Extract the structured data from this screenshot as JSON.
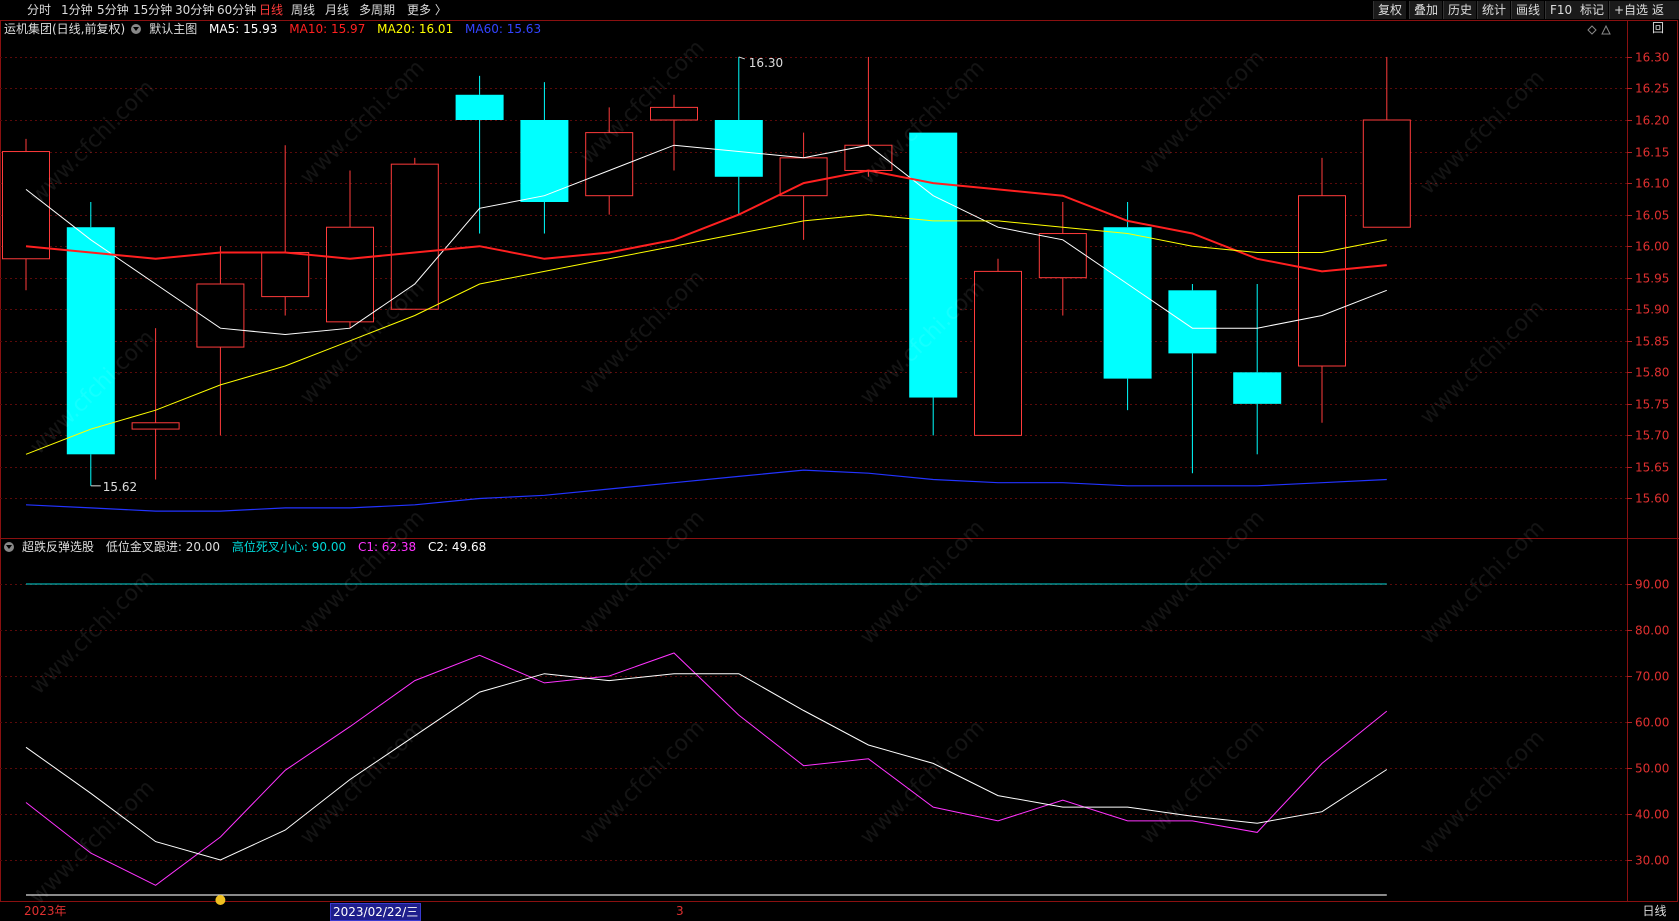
{
  "toolbar": {
    "periods": [
      "分时",
      "1分钟",
      "5分钟",
      "15分钟",
      "30分钟",
      "60分钟",
      "日线",
      "周线",
      "月线",
      "多周期",
      "更多 〉"
    ],
    "active_period": "日线",
    "right_buttons": [
      "复权",
      "叠加",
      "历史",
      "统计",
      "画线",
      "F10",
      "标记",
      "+自选",
      "返回"
    ]
  },
  "main_legend": {
    "stock": "运机集团(日线,前复权)",
    "template": "默认主图",
    "ma5": "MA5: 15.93",
    "ma10": "MA10: 15.97",
    "ma20": "MA20: 16.01",
    "ma60": "MA60: 15.63"
  },
  "sub_legend": {
    "name": "超跌反弹选股",
    "low": "低位金叉跟进: 20.00",
    "high": "高位死叉小心: 90.00",
    "c1": "C1: 62.38",
    "c2": "C2: 49.68"
  },
  "colors": {
    "up": "#ff3b3b",
    "down": "#00ffff",
    "ma5": "#ffffff",
    "ma10": "#ff2020",
    "ma20": "#ffff00",
    "ma60": "#2233ff",
    "c1": "#ff33ff",
    "c2": "#ffffff",
    "axis": "#e03030"
  },
  "annotations": {
    "high": "16.30",
    "low": "15.62"
  },
  "bottom": {
    "year_label": "2023年",
    "current_date": "2023/02/22/三",
    "month_mark": "3",
    "period_box": "日线"
  },
  "watermark": "www.cfchi.com",
  "chart_data": [
    {
      "type": "candlestick",
      "ylim": [
        15.55,
        16.33
      ],
      "y_ticks": [
        "16.30",
        "16.25",
        "16.20",
        "16.15",
        "16.10",
        "16.05",
        "16.00",
        "15.95",
        "15.90",
        "15.85",
        "15.80",
        "15.75",
        "15.70",
        "15.65",
        "15.60"
      ],
      "candles": [
        {
          "o": 15.98,
          "h": 16.17,
          "l": 15.93,
          "c": 16.15
        },
        {
          "o": 16.03,
          "h": 16.07,
          "l": 15.62,
          "c": 15.67
        },
        {
          "o": 15.71,
          "h": 15.87,
          "l": 15.63,
          "c": 15.72
        },
        {
          "o": 15.84,
          "h": 16.0,
          "l": 15.7,
          "c": 15.94
        },
        {
          "o": 15.92,
          "h": 16.16,
          "l": 15.89,
          "c": 15.99
        },
        {
          "o": 15.88,
          "h": 16.12,
          "l": 15.87,
          "c": 16.03
        },
        {
          "o": 15.9,
          "h": 16.14,
          "l": 15.9,
          "c": 16.13
        },
        {
          "o": 16.24,
          "h": 16.27,
          "l": 16.02,
          "c": 16.2
        },
        {
          "o": 16.2,
          "h": 16.26,
          "l": 16.02,
          "c": 16.07
        },
        {
          "o": 16.08,
          "h": 16.22,
          "l": 16.05,
          "c": 16.18
        },
        {
          "o": 16.2,
          "h": 16.24,
          "l": 16.12,
          "c": 16.22
        },
        {
          "o": 16.2,
          "h": 16.3,
          "l": 16.05,
          "c": 16.11
        },
        {
          "o": 16.08,
          "h": 16.18,
          "l": 16.01,
          "c": 16.14
        },
        {
          "o": 16.12,
          "h": 16.3,
          "l": 16.11,
          "c": 16.16
        },
        {
          "o": 16.18,
          "h": 16.18,
          "l": 15.7,
          "c": 15.76
        },
        {
          "o": 15.7,
          "h": 15.98,
          "l": 15.7,
          "c": 15.96
        },
        {
          "o": 15.95,
          "h": 16.07,
          "l": 15.89,
          "c": 16.02
        },
        {
          "o": 16.03,
          "h": 16.07,
          "l": 15.74,
          "c": 15.79
        },
        {
          "o": 15.93,
          "h": 15.94,
          "l": 15.64,
          "c": 15.83
        },
        {
          "o": 15.8,
          "h": 15.94,
          "l": 15.67,
          "c": 15.75
        },
        {
          "o": 15.81,
          "h": 16.14,
          "l": 15.72,
          "c": 16.08
        },
        {
          "o": 16.03,
          "h": 16.3,
          "l": 16.03,
          "c": 16.2
        }
      ],
      "series": [
        {
          "name": "MA5",
          "values": [
            16.09,
            16.01,
            15.94,
            15.87,
            15.86,
            15.87,
            15.94,
            16.06,
            16.08,
            16.12,
            16.16,
            16.15,
            16.14,
            16.16,
            16.08,
            16.03,
            16.01,
            15.94,
            15.87,
            15.87,
            15.89,
            15.93
          ]
        },
        {
          "name": "MA10",
          "values": [
            16.0,
            15.99,
            15.98,
            15.99,
            15.99,
            15.98,
            15.99,
            16.0,
            15.98,
            15.99,
            16.01,
            16.05,
            16.1,
            16.12,
            16.1,
            16.09,
            16.08,
            16.04,
            16.02,
            15.98,
            15.96,
            15.97
          ]
        },
        {
          "name": "MA20",
          "values": [
            15.67,
            15.71,
            15.74,
            15.78,
            15.81,
            15.85,
            15.89,
            15.94,
            15.96,
            15.98,
            16.0,
            16.02,
            16.04,
            16.05,
            16.04,
            16.04,
            16.03,
            16.02,
            16.0,
            15.99,
            15.99,
            16.01
          ]
        },
        {
          "name": "MA60",
          "values": [
            15.59,
            15.585,
            15.58,
            15.58,
            15.585,
            15.585,
            15.59,
            15.6,
            15.605,
            15.615,
            15.625,
            15.635,
            15.645,
            15.64,
            15.63,
            15.625,
            15.625,
            15.62,
            15.62,
            15.62,
            15.625,
            15.63
          ]
        }
      ]
    },
    {
      "type": "line",
      "ylim": [
        25,
        95
      ],
      "y_ticks": [
        "90.00",
        "80.00",
        "70.00",
        "60.00",
        "50.00",
        "40.00",
        "30.00"
      ],
      "series": [
        {
          "name": "C1",
          "values": [
            42.5,
            31.5,
            24.5,
            35,
            49.5,
            59,
            69,
            74.5,
            68.5,
            70,
            75,
            61.5,
            50.5,
            52,
            41.5,
            38.5,
            43,
            38.5,
            38.5,
            36,
            51,
            62.38
          ]
        },
        {
          "name": "C2",
          "values": [
            54.5,
            44.5,
            34,
            30,
            36.5,
            47.5,
            57,
            66.5,
            70.5,
            69,
            70.5,
            70.5,
            62.5,
            55,
            51,
            44,
            41.5,
            41.5,
            39.5,
            38,
            40.5,
            49.68
          ]
        }
      ],
      "hlines": [
        90,
        20
      ]
    }
  ]
}
